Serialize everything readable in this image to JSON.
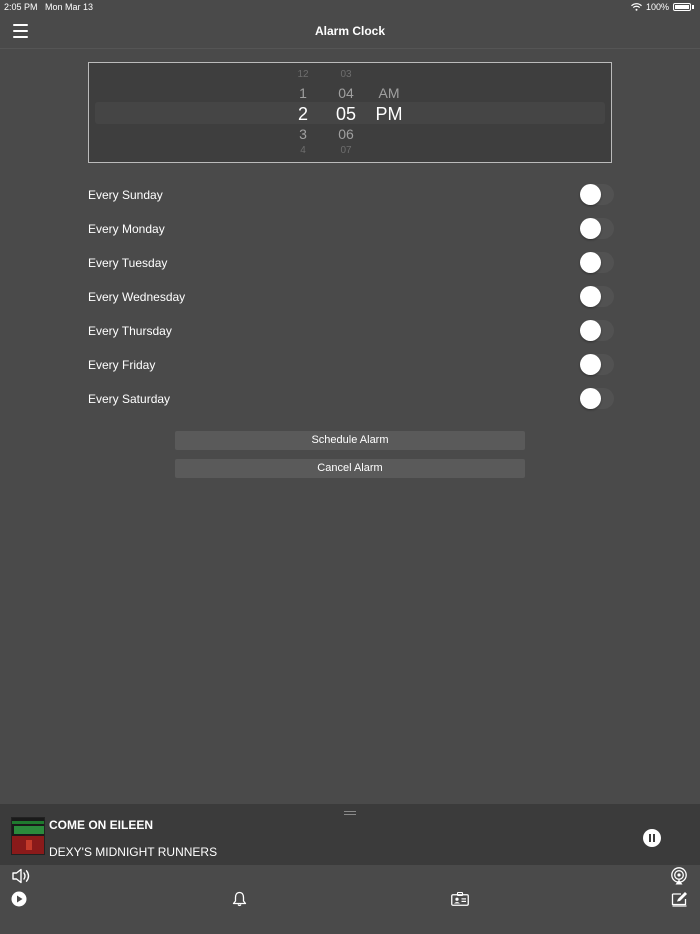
{
  "status_bar": {
    "time": "2:05 PM",
    "date": "Mon Mar 13",
    "battery": "100%"
  },
  "nav": {
    "title": "Alarm Clock",
    "menu_icon": "hamburger-icon"
  },
  "picker": {
    "hours": [
      "12",
      "1",
      "2",
      "3",
      "4"
    ],
    "minutes": [
      "03",
      "04",
      "05",
      "06",
      "07"
    ],
    "periods": [
      "AM",
      "PM"
    ],
    "selected": {
      "hour": "2",
      "minute": "05",
      "period": "PM"
    }
  },
  "days": [
    {
      "label": "Every Sunday",
      "enabled": false
    },
    {
      "label": "Every Monday",
      "enabled": false
    },
    {
      "label": "Every Tuesday",
      "enabled": false
    },
    {
      "label": "Every Wednesday",
      "enabled": false
    },
    {
      "label": "Every Thursday",
      "enabled": false
    },
    {
      "label": "Every Friday",
      "enabled": false
    },
    {
      "label": "Every Saturday",
      "enabled": false
    }
  ],
  "actions": {
    "schedule_label": "Schedule Alarm",
    "cancel_label": "Cancel Alarm"
  },
  "now_playing": {
    "title": "COME ON EILEEN",
    "artist": "DEXY'S MIDNIGHT RUNNERS",
    "state_icon": "pause-icon"
  },
  "tab_bar": {
    "icons": [
      "speaker-icon",
      "play-icon",
      "bell-icon",
      "contact-card-icon",
      "airplay-icon",
      "compose-icon"
    ]
  },
  "colors": {
    "background": "#4a4a4a",
    "now_playing_bg": "#3b3b3b",
    "button_bg": "#5a5a5a",
    "text": "#ffffff"
  }
}
